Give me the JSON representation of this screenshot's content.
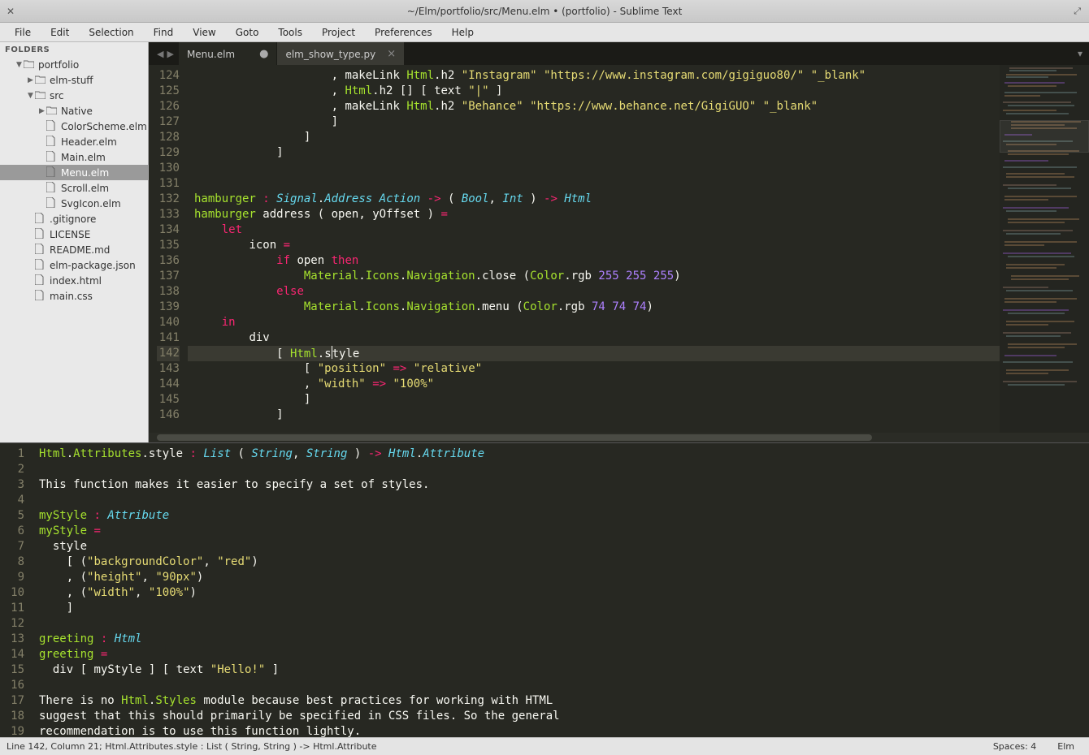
{
  "window": {
    "title": "~/Elm/portfolio/src/Menu.elm • (portfolio) - Sublime Text"
  },
  "menu": {
    "items": [
      "File",
      "Edit",
      "Selection",
      "Find",
      "View",
      "Goto",
      "Tools",
      "Project",
      "Preferences",
      "Help"
    ]
  },
  "sidebar": {
    "header": "FOLDERS",
    "tree": [
      {
        "depth": 0,
        "type": "folder-open",
        "label": "portfolio",
        "expanded": true
      },
      {
        "depth": 1,
        "type": "folder",
        "label": "elm-stuff",
        "expanded": false
      },
      {
        "depth": 1,
        "type": "folder-open",
        "label": "src",
        "expanded": true
      },
      {
        "depth": 2,
        "type": "folder",
        "label": "Native",
        "expanded": false
      },
      {
        "depth": 2,
        "type": "file",
        "label": "ColorScheme.elm"
      },
      {
        "depth": 2,
        "type": "file",
        "label": "Header.elm"
      },
      {
        "depth": 2,
        "type": "file",
        "label": "Main.elm"
      },
      {
        "depth": 2,
        "type": "file",
        "label": "Menu.elm",
        "selected": true
      },
      {
        "depth": 2,
        "type": "file",
        "label": "Scroll.elm"
      },
      {
        "depth": 2,
        "type": "file",
        "label": "SvgIcon.elm"
      },
      {
        "depth": 1,
        "type": "file",
        "label": ".gitignore"
      },
      {
        "depth": 1,
        "type": "file",
        "label": "LICENSE"
      },
      {
        "depth": 1,
        "type": "file",
        "label": "README.md"
      },
      {
        "depth": 1,
        "type": "file",
        "label": "elm-package.json"
      },
      {
        "depth": 1,
        "type": "file",
        "label": "index.html"
      },
      {
        "depth": 1,
        "type": "file",
        "label": "main.css"
      }
    ]
  },
  "tabs": [
    {
      "label": "Menu.elm",
      "active": true,
      "dirty": true
    },
    {
      "label": "elm_show_type.py",
      "active": false,
      "dirty": false
    }
  ],
  "editor": {
    "first_line": 124,
    "highlight_line": 142,
    "lines": [
      {
        "n": 124,
        "html": "                    <span class='pn'>,</span> <span class='def'>makeLink</span> <span class='nm'>Html</span><span class='pn'>.</span><span class='def'>h2</span> <span class='str'>\"Instagram\"</span> <span class='str'>\"https://www.instagram.com/gigiguo80/\"</span> <span class='str'>\"_blank\"</span>"
      },
      {
        "n": 125,
        "html": "                    <span class='pn'>,</span> <span class='nm'>Html</span><span class='pn'>.</span><span class='def'>h2</span> <span class='br'>[]</span> <span class='br'>[</span> <span class='def'>text</span> <span class='str'>\"|\"</span> <span class='br'>]</span>"
      },
      {
        "n": 126,
        "html": "                    <span class='pn'>,</span> <span class='def'>makeLink</span> <span class='nm'>Html</span><span class='pn'>.</span><span class='def'>h2</span> <span class='str'>\"Behance\"</span> <span class='str'>\"https://www.behance.net/GigiGUO\"</span> <span class='str'>\"_blank\"</span>"
      },
      {
        "n": 127,
        "html": "                    <span class='br'>]</span>"
      },
      {
        "n": 128,
        "html": "                <span class='br'>]</span>"
      },
      {
        "n": 129,
        "html": "            <span class='br'>]</span>"
      },
      {
        "n": 130,
        "html": ""
      },
      {
        "n": 131,
        "html": ""
      },
      {
        "n": 132,
        "html": "<span class='nm'>hamburger</span> <span class='op'>:</span> <span class='ty'>Signal</span><span class='pn'>.</span><span class='ty'>Address</span> <span class='ty'>Action</span> <span class='op'>-&gt;</span> <span class='pn'>(</span> <span class='ty'>Bool</span><span class='pn'>,</span> <span class='ty'>Int</span> <span class='pn'>)</span> <span class='op'>-&gt;</span> <span class='ty'>Html</span>"
      },
      {
        "n": 133,
        "html": "<span class='nm'>hamburger</span> <span class='def'>address</span> <span class='pn'>(</span> <span class='def'>open</span><span class='pn'>,</span> <span class='def'>yOffset</span> <span class='pn'>)</span> <span class='op'>=</span>"
      },
      {
        "n": 134,
        "html": "    <span class='kw'>let</span>"
      },
      {
        "n": 135,
        "html": "        <span class='def'>icon</span> <span class='op'>=</span>"
      },
      {
        "n": 136,
        "html": "            <span class='kw'>if</span> <span class='def'>open</span> <span class='kw'>then</span>"
      },
      {
        "n": 137,
        "html": "                <span class='nm'>Material</span><span class='pn'>.</span><span class='nm'>Icons</span><span class='pn'>.</span><span class='nm'>Navigation</span><span class='pn'>.</span><span class='def'>close</span> <span class='pn'>(</span><span class='nm'>Color</span><span class='pn'>.</span><span class='def'>rgb</span> <span class='num'>255</span> <span class='num'>255</span> <span class='num'>255</span><span class='pn'>)</span>"
      },
      {
        "n": 138,
        "html": "            <span class='kw'>else</span>"
      },
      {
        "n": 139,
        "html": "                <span class='nm'>Material</span><span class='pn'>.</span><span class='nm'>Icons</span><span class='pn'>.</span><span class='nm'>Navigation</span><span class='pn'>.</span><span class='def'>menu</span> <span class='pn'>(</span><span class='nm'>Color</span><span class='pn'>.</span><span class='def'>rgb</span> <span class='num'>74</span> <span class='num'>74</span> <span class='num'>74</span><span class='pn'>)</span>"
      },
      {
        "n": 140,
        "html": "    <span class='kw'>in</span>"
      },
      {
        "n": 141,
        "html": "        <span class='def'>div</span>"
      },
      {
        "n": 142,
        "html": "            <span class='br'>[</span> <span class='nm'>Html</span><span class='pn'>.</span><span class='def'>s</span><span class='caret'></span><span class='def'>tyle</span>"
      },
      {
        "n": 143,
        "html": "                <span class='br'>[</span> <span class='str'>\"position\"</span> <span class='op'>=&gt;</span> <span class='str'>\"relative\"</span>"
      },
      {
        "n": 144,
        "html": "                <span class='pn'>,</span> <span class='str'>\"width\"</span> <span class='op'>=&gt;</span> <span class='str'>\"100%\"</span>"
      },
      {
        "n": 145,
        "html": "                <span class='br'>]</span>"
      },
      {
        "n": 146,
        "html": "            <span class='br'>]</span>"
      }
    ]
  },
  "panel": {
    "first_line": 1,
    "lines": [
      {
        "n": 1,
        "html": "<span class='nm'>Html</span><span class='pn'>.</span><span class='nm'>Attributes</span><span class='pn'>.</span><span class='def'>style</span> <span class='op'>:</span> <span class='ty'>List</span> <span class='pn'>(</span> <span class='ty'>String</span><span class='pn'>,</span> <span class='ty'>String</span> <span class='pn'>)</span> <span class='op'>-&gt;</span> <span class='ty'>Html</span><span class='pn'>.</span><span class='ty'>Attribute</span>"
      },
      {
        "n": 2,
        "html": ""
      },
      {
        "n": 3,
        "html": "<span class='def'>This function makes it easier to specify a set of styles.</span>"
      },
      {
        "n": 4,
        "html": ""
      },
      {
        "n": 5,
        "html": "<span class='nm'>myStyle</span> <span class='op'>:</span> <span class='ty'>Attribute</span>"
      },
      {
        "n": 6,
        "html": "<span class='nm'>myStyle</span> <span class='op'>=</span>"
      },
      {
        "n": 7,
        "html": "  <span class='def'>style</span>"
      },
      {
        "n": 8,
        "html": "    <span class='br'>[</span> <span class='pn'>(</span><span class='str'>\"backgroundColor\"</span><span class='pn'>,</span> <span class='str'>\"red\"</span><span class='pn'>)</span>"
      },
      {
        "n": 9,
        "html": "    <span class='pn'>,</span> <span class='pn'>(</span><span class='str'>\"height\"</span><span class='pn'>,</span> <span class='str'>\"90px\"</span><span class='pn'>)</span>"
      },
      {
        "n": 10,
        "html": "    <span class='pn'>,</span> <span class='pn'>(</span><span class='str'>\"width\"</span><span class='pn'>,</span> <span class='str'>\"100%\"</span><span class='pn'>)</span>"
      },
      {
        "n": 11,
        "html": "    <span class='br'>]</span>"
      },
      {
        "n": 12,
        "html": ""
      },
      {
        "n": 13,
        "html": "<span class='nm'>greeting</span> <span class='op'>:</span> <span class='ty'>Html</span>"
      },
      {
        "n": 14,
        "html": "<span class='nm'>greeting</span> <span class='op'>=</span>"
      },
      {
        "n": 15,
        "html": "  <span class='def'>div</span> <span class='br'>[</span> <span class='def'>myStyle</span> <span class='br'>]</span> <span class='br'>[</span> <span class='def'>text</span> <span class='str'>\"Hello!\"</span> <span class='br'>]</span>"
      },
      {
        "n": 16,
        "html": ""
      },
      {
        "n": 17,
        "html": "<span class='def'>There is no </span><span class='nm'>Html</span><span class='pn'>.</span><span class='nm'>Styles</span><span class='def'> module because best practices for working with HTML</span>"
      },
      {
        "n": 18,
        "html": "<span class='def'>suggest that this should primarily be specified in CSS files. So the general</span>"
      },
      {
        "n": 19,
        "html": "<span class='def'>recommendation is to use this function lightly.</span>"
      }
    ]
  },
  "status": {
    "left": "Line 142, Column 21; Html.Attributes.style : List ( String, String ) -> Html.Attribute",
    "spaces": "Spaces: 4",
    "syntax": "Elm"
  }
}
